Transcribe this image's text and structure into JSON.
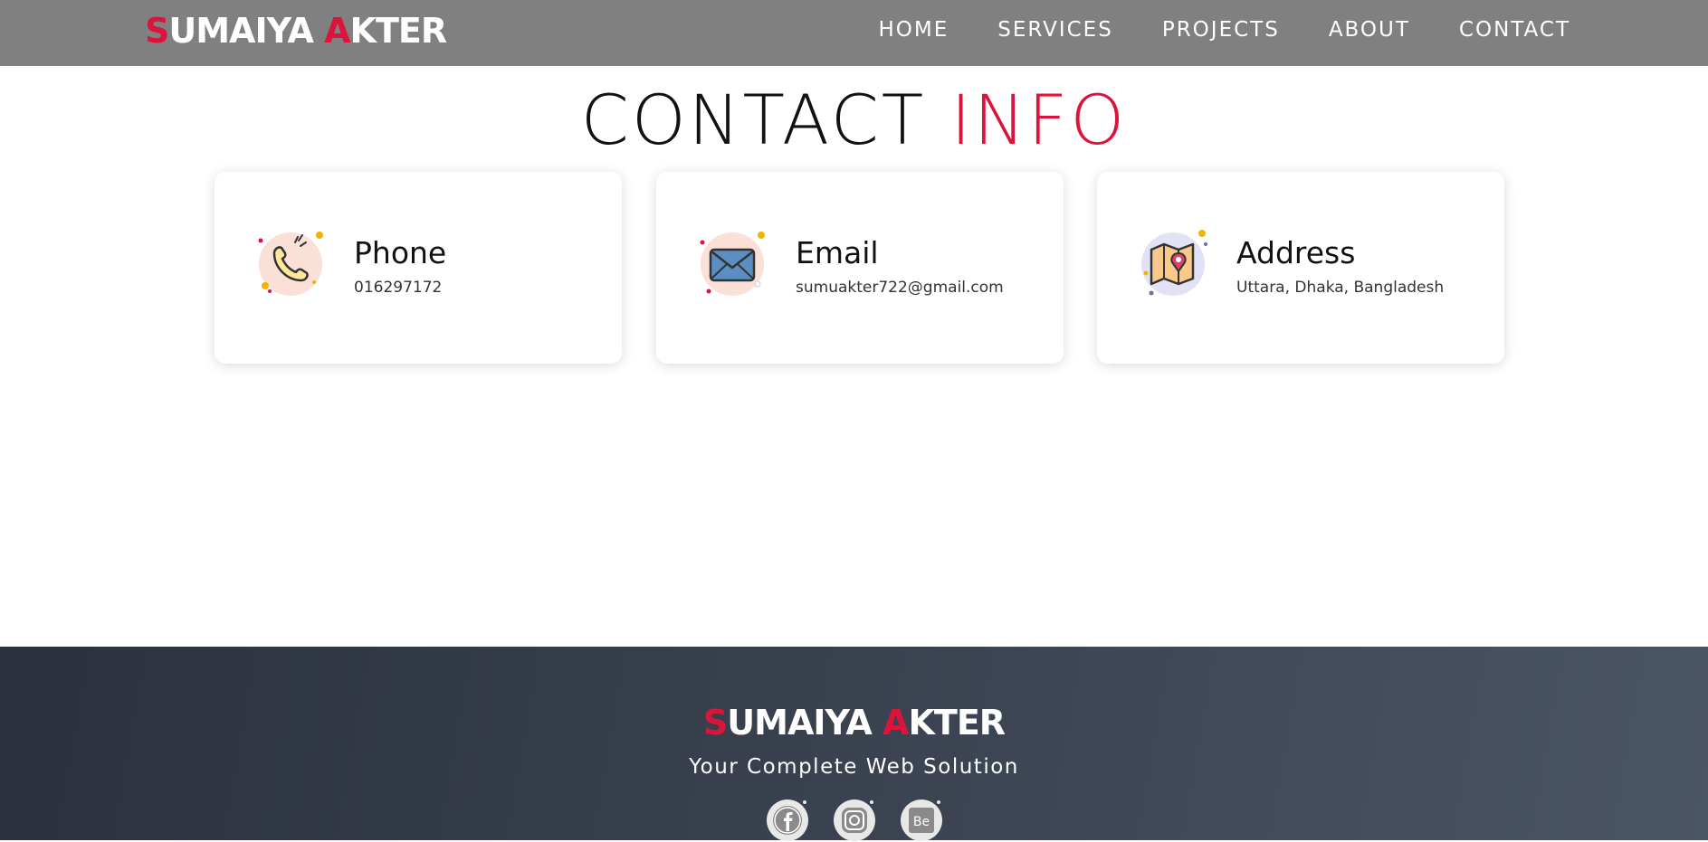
{
  "header": {
    "brand": {
      "first_initial": "S",
      "first_rest": "UMAIYA ",
      "last_initial": "A",
      "last_rest": "KTER"
    },
    "nav": [
      "HOME",
      "SERVICES",
      "PROJECTS",
      "ABOUT",
      "CONTACT"
    ]
  },
  "contact": {
    "title_main": "CONTACT ",
    "title_accent": "INFO",
    "cards": [
      {
        "heading": "Phone",
        "detail": "016297172",
        "icon": "phone-icon"
      },
      {
        "heading": "Email",
        "detail": "sumuakter722@gmail.com",
        "icon": "envelope-icon"
      },
      {
        "heading": "Address",
        "detail": "Uttara, Dhaka, Bangladesh",
        "icon": "map-pin-icon"
      }
    ]
  },
  "footer": {
    "brand": {
      "first_initial": "S",
      "first_rest": "UMAIYA ",
      "last_initial": "A",
      "last_rest": "KTER"
    },
    "tagline": "Your Complete Web Solution",
    "socials": [
      "facebook-icon",
      "instagram-icon",
      "behance-icon"
    ],
    "behance_text": "Be"
  },
  "colors": {
    "accent": "#dc143c",
    "navbar": "#808080",
    "footer": "#2b313d"
  }
}
